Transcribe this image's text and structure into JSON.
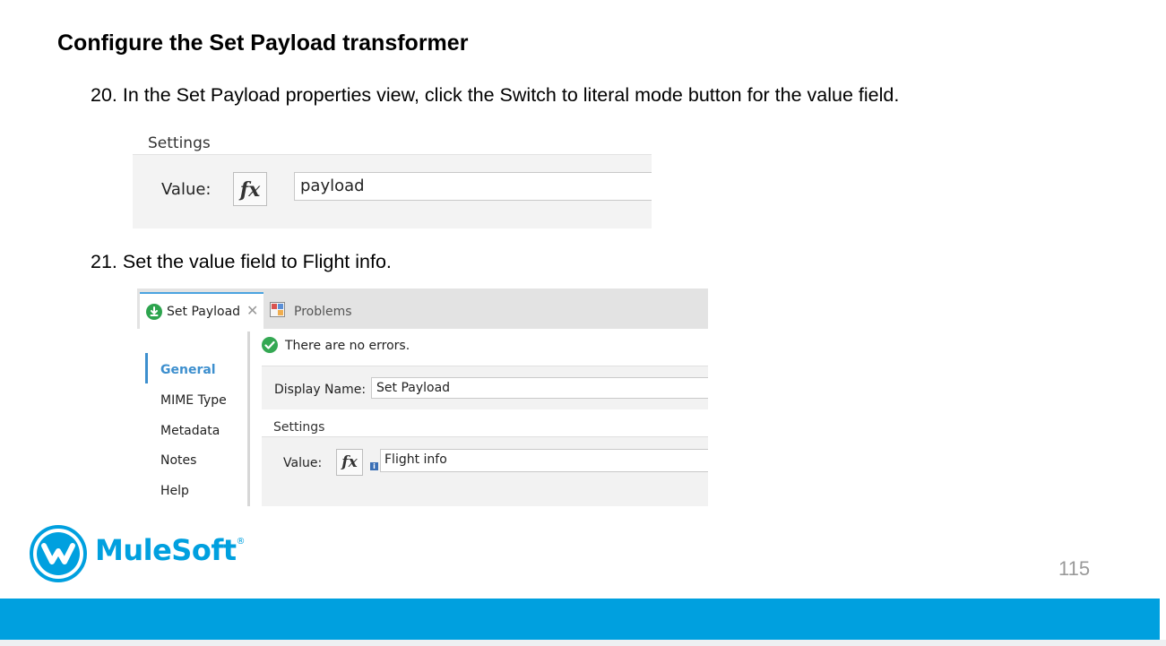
{
  "slide": {
    "title": "Configure the Set Payload transformer",
    "page_number": "115"
  },
  "steps": [
    {
      "number": "20.",
      "text": "In the Set Payload properties view, click the Switch to literal mode button for the value field."
    },
    {
      "number": "21.",
      "text": "Set the value field to Flight info."
    }
  ],
  "screenshot1": {
    "settings_label": "Settings",
    "value_label": "Value:",
    "fx_label": "fx",
    "value_input": "payload"
  },
  "screenshot2": {
    "tabs": [
      {
        "label": "Set Payload",
        "close": "✕"
      },
      {
        "label": "Problems"
      }
    ],
    "sidebar": [
      "General",
      "MIME Type",
      "Metadata",
      "Notes",
      "Help"
    ],
    "status_text": "There are no errors.",
    "display_name_label": "Display Name:",
    "display_name_value": "Set Payload",
    "settings_label": "Settings",
    "value_label": "Value:",
    "fx_label": "fx",
    "info_badge": "i",
    "value_input": "Flight info"
  },
  "brand": {
    "logo_text": "MuleSoft",
    "trademark": "®",
    "color": "#00a0df"
  }
}
